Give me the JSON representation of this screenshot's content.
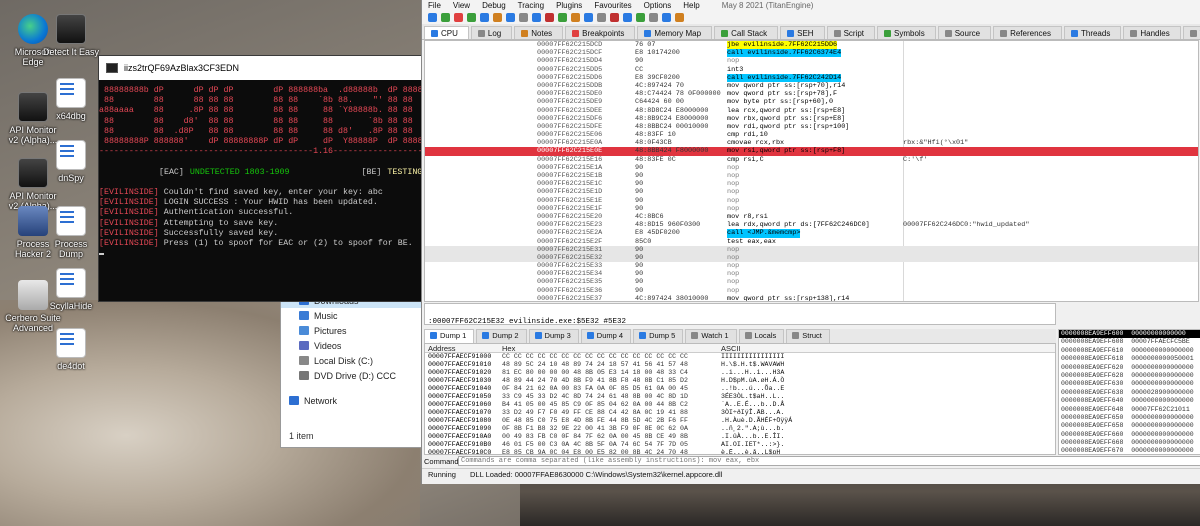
{
  "desktop": {
    "icons": [
      {
        "label": "Microsoft Edge",
        "icon": "edge-icon"
      },
      {
        "label": "Detect It Easy",
        "icon": "app-icon"
      },
      {
        "label": "API Monitor v2 (Alpha)...",
        "icon": "api-monitor-icon"
      },
      {
        "label": "x64dbg",
        "icon": "document-icon"
      },
      {
        "label": "API Monitor v2 (Alpha)...",
        "icon": "api-monitor-icon"
      },
      {
        "label": "dnSpy",
        "icon": "document-icon"
      },
      {
        "label": "Process Hacker 2",
        "icon": "process-hacker-icon"
      },
      {
        "label": "Process Dump",
        "icon": "document-icon"
      },
      {
        "label": "Cerbero Suite Advanced",
        "icon": "cerbero-icon"
      },
      {
        "label": "ScyllaHide",
        "icon": "document-icon"
      },
      {
        "label": "de4dot",
        "icon": "document-icon"
      }
    ]
  },
  "explorer": {
    "nav": [
      {
        "label": "Downloads",
        "selected": true
      },
      {
        "label": "Music"
      },
      {
        "label": "Pictures"
      },
      {
        "label": "Videos"
      },
      {
        "label": "Local Disk (C:)"
      },
      {
        "label": "DVD Drive (D:) CCC"
      },
      {
        "label": "Network"
      }
    ],
    "status": "1 item"
  },
  "console": {
    "title": "iizs2trQF69AzBlax3CF3EDN",
    "banner": [
      " 88888888b dP      dP dP dP        dP 888888ba  .d88888b  dP 888888ba   88888888b",
      " 88        88      88 88 88        88 88    `8b 88.    \"' 88 88    `8b  88",
      "a88aaaa    88     .8P 88 88        88 88     88 `Y88888b. 88 88     88 a88aaaa",
      " 88        88    d8'  88 88        88 88     88       `8b 88 88     88  88",
      " 88        88  .d8P   88 88        88 88     88 d8'   .8P 88 88     .8P  88",
      " 88888888P 888888'    dP 88888888P dP dP     dP  Y88888P  dP 8888888P   88888888P"
    ],
    "version_line": "-------------------------------------------1.16--------------------------------------",
    "eac_tag": "[EAC]",
    "eac_status": "UNDETECTED 1803-1909",
    "be_tag": "[BE]",
    "be_status": "TESTING 1803-20H2",
    "log": [
      {
        "tag": "[EVILINSIDE]",
        "text": " Couldn't find saved key, enter your key: abc"
      },
      {
        "tag": "[EVILINSIDE]",
        "text": " LOGIN SUCCESS : Your HWID has been updated."
      },
      {
        "tag": "[EVILINSIDE]",
        "text": " Authentication successful."
      },
      {
        "tag": "[EVILINSIDE]",
        "text": " Attempting to save key."
      },
      {
        "tag": "[EVILINSIDE]",
        "text": " Successfully saved key."
      },
      {
        "tag": "[EVILINSIDE]",
        "text": " Press (1) to spoof for EAC or (2) to spoof for BE."
      }
    ],
    "controls": {
      "minimize": "—",
      "maximize": "☐",
      "close": "✕"
    }
  },
  "debugger": {
    "menu": [
      "File",
      "View",
      "Debug",
      "Tracing",
      "Plugins",
      "Favourites",
      "Options",
      "Help"
    ],
    "date": "May 8 2021 (TitanEngine)",
    "toolbar_colors": [
      "#2a7ae2",
      "#3b9f3b",
      "#e04040",
      "#3b9f3b",
      "#2a7ae2",
      "#d08020",
      "#2a7ae2",
      "#888888",
      "#2a7ae2",
      "#c03030",
      "#3b9f3b",
      "#d08020",
      "#2a7ae2",
      "#888888",
      "#c03030",
      "#2a7ae2",
      "#3b9f3b",
      "#888888",
      "#2a7ae2",
      "#d08020"
    ],
    "tabs": [
      {
        "label": "CPU",
        "color": "#2a7ae2",
        "active": true
      },
      {
        "label": "Log",
        "color": "#888888"
      },
      {
        "label": "Notes",
        "color": "#d08020"
      },
      {
        "label": "Breakpoints",
        "color": "#e04040"
      },
      {
        "label": "Memory Map",
        "color": "#2a7ae2"
      },
      {
        "label": "Call Stack",
        "color": "#3b9f3b"
      },
      {
        "label": "SEH",
        "color": "#2a7ae2"
      },
      {
        "label": "Script",
        "color": "#888888"
      },
      {
        "label": "Symbols",
        "color": "#3b9f3b"
      },
      {
        "label": "Source",
        "color": "#888888"
      },
      {
        "label": "References",
        "color": "#888888"
      },
      {
        "label": "Threads",
        "color": "#2a7ae2"
      },
      {
        "label": "Handles",
        "color": "#888888"
      },
      {
        "label": "Trace",
        "color": "#888888"
      }
    ],
    "cpu_rows": [
      {
        "addr": "00007FF62C215DCD",
        "bytes": "76 07",
        "instr": "jbe evilinside.7FF62C215DD6",
        "kind": "jmp",
        "cmt": ""
      },
      {
        "addr": "00007FF62C215DCF",
        "bytes": "E8 10174200",
        "instr": "call evilinside.7FF62C6374E4",
        "kind": "call",
        "cmt": ""
      },
      {
        "addr": "00007FF62C215DD4",
        "bytes": "90",
        "instr": "nop",
        "kind": "nop",
        "cmt": ""
      },
      {
        "addr": "00007FF62C215DD5",
        "bytes": "CC",
        "instr": "int3",
        "kind": "",
        "cmt": ""
      },
      {
        "addr": "00007FF62C215DD6",
        "bytes": "E8 39CF0200",
        "instr": "call evilinside.7FF62C242D14",
        "kind": "call",
        "cmt": ""
      },
      {
        "addr": "00007FF62C215DDB",
        "bytes": "4C:897424 70",
        "instr": "mov qword ptr ss:[rsp+70],r14",
        "kind": "",
        "cmt": ""
      },
      {
        "addr": "00007FF62C215DE0",
        "bytes": "48:C74424 78 0F000000",
        "instr": "mov qword ptr ss:[rsp+78],F",
        "kind": "",
        "cmt": ""
      },
      {
        "addr": "00007FF62C215DE9",
        "bytes": "C64424 60 00",
        "instr": "mov byte ptr ss:[rsp+60],0",
        "kind": "",
        "cmt": ""
      },
      {
        "addr": "00007FF62C215DEE",
        "bytes": "48:8D8C24 E8000000",
        "instr": "lea rcx,qword ptr ss:[rsp+E8]",
        "kind": "",
        "cmt": ""
      },
      {
        "addr": "00007FF62C215DF6",
        "bytes": "48:8B9C24 E8000000",
        "instr": "mov rbx,qword ptr ss:[rsp+E8]",
        "kind": "",
        "cmt": ""
      },
      {
        "addr": "00007FF62C215DFE",
        "bytes": "48:8BBC24 00010000",
        "instr": "mov rdi,qword ptr ss:[rsp+100]",
        "kind": "",
        "cmt": ""
      },
      {
        "addr": "00007FF62C215E06",
        "bytes": "48:83FF 10",
        "instr": "cmp rdi,10",
        "kind": "",
        "cmt": ""
      },
      {
        "addr": "00007FF62C215E0A",
        "bytes": "48:0F43CB",
        "instr": "cmovae rcx,rbx",
        "kind": "",
        "cmt": "rbx:&\"Hfi(°\\x01\""
      },
      {
        "addr": "00007FF62C215E0E",
        "bytes": "48:8BB424 F8000000",
        "instr": "mov rsi,qword ptr ss:[rsp+F8]",
        "kind": "",
        "cmt": "",
        "bp": true
      },
      {
        "addr": "00007FF62C215E16",
        "bytes": "48:83FE 0C",
        "instr": "cmp rsi,C",
        "kind": "",
        "cmt": "C:'\\f'"
      },
      {
        "addr": "00007FF62C215E1A",
        "bytes": "90",
        "instr": "nop",
        "kind": "nop",
        "cmt": ""
      },
      {
        "addr": "00007FF62C215E1B",
        "bytes": "90",
        "instr": "nop",
        "kind": "nop",
        "cmt": ""
      },
      {
        "addr": "00007FF62C215E1C",
        "bytes": "90",
        "instr": "nop",
        "kind": "nop",
        "cmt": ""
      },
      {
        "addr": "00007FF62C215E1D",
        "bytes": "90",
        "instr": "nop",
        "kind": "nop",
        "cmt": ""
      },
      {
        "addr": "00007FF62C215E1E",
        "bytes": "90",
        "instr": "nop",
        "kind": "nop",
        "cmt": ""
      },
      {
        "addr": "00007FF62C215E1F",
        "bytes": "90",
        "instr": "nop",
        "kind": "nop",
        "cmt": ""
      },
      {
        "addr": "00007FF62C215E20",
        "bytes": "4C:8BC6",
        "instr": "mov r8,rsi",
        "kind": "",
        "cmt": ""
      },
      {
        "addr": "00007FF62C215E23",
        "bytes": "48:8D15 960F0300",
        "instr": "lea rdx,qword ptr ds:[7FF62C246DC0]",
        "kind": "",
        "cmt": "00007FF62C246DC0:\"hwid_updated\""
      },
      {
        "addr": "00007FF62C215E2A",
        "bytes": "E8 45DF0200",
        "instr": "call <JMP.&memcmp>",
        "kind": "call",
        "cmt": ""
      },
      {
        "addr": "00007FF62C215E2F",
        "bytes": "85C0",
        "instr": "test eax,eax",
        "kind": "",
        "cmt": ""
      },
      {
        "addr": "00007FF62C215E31",
        "bytes": "90",
        "instr": "nop",
        "kind": "nop",
        "cmt": "",
        "hl": true
      },
      {
        "addr": "00007FF62C215E32",
        "bytes": "90",
        "instr": "nop",
        "kind": "nop",
        "cmt": "",
        "hl": true
      },
      {
        "addr": "00007FF62C215E33",
        "bytes": "90",
        "instr": "nop",
        "kind": "nop",
        "cmt": ""
      },
      {
        "addr": "00007FF62C215E34",
        "bytes": "90",
        "instr": "nop",
        "kind": "nop",
        "cmt": ""
      },
      {
        "addr": "00007FF62C215E35",
        "bytes": "90",
        "instr": "nop",
        "kind": "nop",
        "cmt": ""
      },
      {
        "addr": "00007FF62C215E36",
        "bytes": "90",
        "instr": "nop",
        "kind": "nop",
        "cmt": ""
      },
      {
        "addr": "00007FF62C215E37",
        "bytes": "4C:897424 38010000",
        "instr": "mov qword ptr ss:[rsp+138],r14",
        "kind": "",
        "cmt": ""
      },
      {
        "addr": "00007FF62C215E3F",
        "bytes": "48:C78424 40010000 0F",
        "instr": "mov qword ptr ss:[rsp+140],F",
        "kind": "",
        "cmt": ""
      },
      {
        "addr": "00007FF62C215E4B",
        "bytes": "C68424 28010000",
        "instr": "mov byte ptr ss:[rsp+128],al",
        "kind": "",
        "cmt": ""
      },
      {
        "addr": "00007FF62C215E52",
        "bytes": "44:8D46 20",
        "instr": "lea r8d,qword ptr ds:[rsi+20]",
        "kind": "",
        "cmt": ""
      }
    ],
    "info_line": ":00007FF62C215E32  evilinside.exe:$5E32  #5E32",
    "dump_tabs": [
      {
        "label": "Dump 1",
        "active": true
      },
      {
        "label": "Dump 2"
      },
      {
        "label": "Dump 3"
      },
      {
        "label": "Dump 4"
      },
      {
        "label": "Dump 5"
      },
      {
        "label": "Watch 1"
      },
      {
        "label": "Locals"
      },
      {
        "label": "Struct"
      }
    ],
    "dump_headers": {
      "address": "Address",
      "hex": "Hex",
      "ascii": "ASCII"
    },
    "dump_rows": [
      {
        "addr": "00007FFAECF91000",
        "hex": "CC CC CC CC CC CC CC CC CC CC CC CC CC CC CC CC",
        "ascii": "IIIIIIIIIIIIIIII"
      },
      {
        "addr": "00007FFAECF91010",
        "hex": "48 89 5C 24 10 48 89 74 24 18 57 41 56 41 57 48",
        "ascii": "H.\\$.H.t$.WAVAWH"
      },
      {
        "addr": "00007FFAECF91020",
        "hex": "81 EC 80 00 00 00 48 8B 05 E3 14 18 00 48 33 C4",
        "ascii": "..i...H..i...H3A"
      },
      {
        "addr": "00007FFAECF91030",
        "hex": "48 89 44 24 70 4D 8B F9 41 8B F8 48 8B C1 85 D2",
        "ascii": "H.D$pM.ùA.øH.Á.Ò"
      },
      {
        "addr": "00007FFAECF91040",
        "hex": "0F 84 21 62 0A 00 83 FA 0A 0F 85 D5 61 0A 00 45",
        "ascii": "..!b...ú...Õa..E"
      },
      {
        "addr": "00007FFAECF91050",
        "hex": "33 C9 45 33 D2 4C 8D 74 24 61 48 8B 00 4C 8D 1D",
        "ascii": "3ÉE3ÒL.t$aH..L.."
      },
      {
        "addr": "00007FFAECF91060",
        "hex": "B4 41 05 00 45 85 C9 0F 85 04 62 0A 00 44 8B C2",
        "ascii": "´A..E.É...b..D.Â"
      },
      {
        "addr": "00007FFAECF91070",
        "hex": "33 D2 49 F7 F0 49 FF CE 88 C4 42 8A 0C 19 41 88",
        "ascii": "3ÒI÷ðIÿÎ.ÄB...A."
      },
      {
        "addr": "00007FFAECF91080",
        "hex": "0E 48 85 C0 75 E8 4D 8B FE 44 8B 5D 4C 2B F6 FF",
        "ascii": ".H.Àuè.D.ÃHÉF+ÖÿÿÁ"
      },
      {
        "addr": "00007FFAECF91090",
        "hex": "0F 8B F1 B8 32 9E 22 00 41 3B F9 0F 8E 0C 62 0A",
        "ascii": "..ñ¸2.\".A;ù...b."
      },
      {
        "addr": "00007FFAECF910A0",
        "hex": "00 49 83 FB C0 0F 84 7F 62 0A 00 45 8B CE 49 8B",
        "ascii": ".I.ûÀ...b..E.ÎI."
      },
      {
        "addr": "00007FFAECF910B0",
        "hex": "46 01 F5 00 C3 0A 4C 8B 5F 0A 74 6C 54 7F 7D 05",
        "ascii": "AI.OI.IET*..:>}."
      },
      {
        "addr": "00007FFAECF910C0",
        "hex": "E8 85 CB 9A 0C 04 E8 00 E5 82 00 8B 4C 24 70 48",
        "ascii": "è.Ë...è.å..L$pH"
      },
      {
        "addr": "00007FFAECF910D0",
        "hex": "33 CC E8 5B 10 09 00 0F 6B 5C 24 00 B1 8B 5C 24",
        "ascii": "3Ìè[....k\\$.±.\\$"
      },
      {
        "addr": "00007FFAECF910E0",
        "hex": "49 8B E3 41 5F 41 5E 5F C3 CC CC CC CC CC CC CC",
        "ascii": "I.ãA_A^_ÃÌÌÌÌÌÌÌ"
      }
    ],
    "stack_rows": [
      {
        "text": "0000008EA9EFF600  00000000000000",
        "sel": true
      },
      {
        "text": "0000008EA9EFF608  00007FFAECFC5BE"
      },
      {
        "text": "0000008EA9EFF610  0000000000000000"
      },
      {
        "text": "0000008EA9EFF618  0000000000050001"
      },
      {
        "text": "0000008EA9EFF620  0000000000000000"
      },
      {
        "text": "0000008EA9EFF628  0000000000000000"
      },
      {
        "text": "0000008EA9EFF630  0000000000000000"
      },
      {
        "text": "0000008EA9EFF638  0000028900000000"
      },
      {
        "text": "0000008EA9EFF640  0000000000000000"
      },
      {
        "text": "0000008EA9EFF648  00007FF62C21011"
      },
      {
        "text": "0000008EA9EFF650  0000000000000000"
      },
      {
        "text": "0000008EA9EFF658  0000000000000000"
      },
      {
        "text": "0000008EA9EFF660  0000000000000000"
      },
      {
        "text": "0000008EA9EFF668  0000000000000000"
      },
      {
        "text": "0000008EA9EFF670  0000000000000000"
      }
    ],
    "command_label": "Command:",
    "command_placeholder": "Commands are comma separated (like assembly instructions): mov eax, ebx",
    "status_state": "Running",
    "status_msg": "DLL Loaded: 00007FFAE8630000 C:\\Windows\\System32\\kernel.appcore.dll"
  }
}
